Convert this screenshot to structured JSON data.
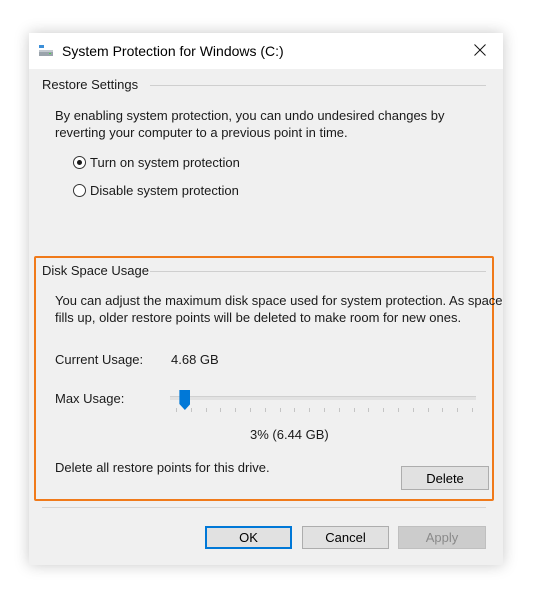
{
  "window": {
    "title": "System Protection for Windows (C:)",
    "icon": "drive-icon",
    "close_icon": "close-icon"
  },
  "restore_settings": {
    "label": "Restore Settings",
    "description_line1": "By enabling system protection, you can undo undesired changes by",
    "description_line2": "reverting your computer to a previous point in time.",
    "options": [
      {
        "label": "Turn on system protection",
        "checked": true
      },
      {
        "label": "Disable system protection",
        "checked": false
      }
    ]
  },
  "disk_space": {
    "label": "Disk Space Usage",
    "description_line1": "You can adjust the maximum disk space used for system protection. As space",
    "description_line2": "fills up, older restore points will be deleted to make room for new ones.",
    "current_usage_label": "Current Usage:",
    "current_usage_value": "4.68 GB",
    "max_usage_label": "Max Usage:",
    "max_usage_percent": 3,
    "max_usage_display": "3% (6.44 GB)",
    "delete_text": "Delete all restore points for this drive.",
    "delete_button": "Delete"
  },
  "footer": {
    "ok": "OK",
    "cancel": "Cancel",
    "apply": "Apply"
  },
  "colors": {
    "accent": "#0078d7",
    "highlight": "#f07a1a"
  }
}
